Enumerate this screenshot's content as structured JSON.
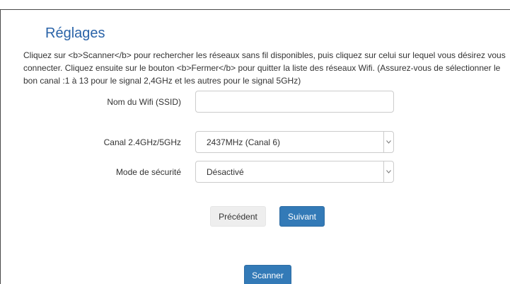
{
  "page": {
    "title": "Réglages",
    "description_lines": [
      "Cliquez sur <b>Scanner</b> pour rechercher les réseaux sans fil disponibles, puis cliquez sur celui sur lequel vous désirez vous",
      "connecter. Cliquez ensuite sur le bouton <b>Fermer</b> pour quitter la liste des réseaux Wifi. (Assurez-vous de sélectionner le",
      "bon canal :1 à 13 pour le signal 2,4GHz et les autres pour le signal 5GHz)"
    ]
  },
  "form": {
    "ssid": {
      "label": "Nom du Wifi (SSID)",
      "value": ""
    },
    "channel": {
      "label": "Canal 2.4GHz/5GHz",
      "value": "2437MHz (Canal 6)"
    },
    "security": {
      "label": "Mode de sécurité",
      "value": "Désactivé"
    }
  },
  "buttons": {
    "previous": "Précédent",
    "next": "Suivant",
    "scan": "Scanner"
  },
  "colors": {
    "title": "#2a63a8",
    "primary": "#337ab7",
    "default_button": "#eeeeee"
  }
}
